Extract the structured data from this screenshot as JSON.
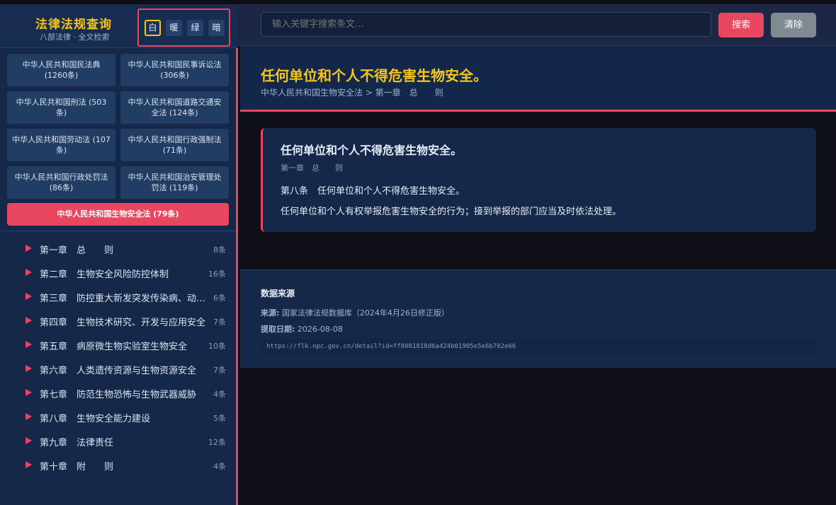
{
  "sidebar": {
    "title": "法律法规查询",
    "subtitle": "八部法律 · 全文检索",
    "themes": [
      {
        "label": "白",
        "active": true
      },
      {
        "label": "暖",
        "active": false
      },
      {
        "label": "绿",
        "active": false
      },
      {
        "label": "暗",
        "active": false
      }
    ],
    "laws": [
      "中华人民共和国民法典 (1260条)",
      "中华人民共和国民事诉讼法 (306条)",
      "中华人民共和国刑法 (503条)",
      "中华人民共和国道路交通安全法 (124条)",
      "中华人民共和国劳动法 (107条)",
      "中华人民共和国行政强制法 (71条)",
      "中华人民共和国行政处罚法 (86条)",
      "中华人民共和国治安管理处罚法 (119条)"
    ],
    "active_law": "中华人民共和国生物安全法 (79条)",
    "chapters": [
      {
        "title": "第一章　总　　则",
        "count": "8条"
      },
      {
        "title": "第二章　生物安全风险防控体制",
        "count": "16条"
      },
      {
        "title": "第三章　防控重大新发突发传染病、动植物疫情",
        "count": "6条"
      },
      {
        "title": "第四章　生物技术研究、开发与应用安全",
        "count": "7条"
      },
      {
        "title": "第五章　病原微生物实验室生物安全",
        "count": "10条"
      },
      {
        "title": "第六章　人类遗传资源与生物资源安全",
        "count": "7条"
      },
      {
        "title": "第七章　防范生物恐怖与生物武器威胁",
        "count": "4条"
      },
      {
        "title": "第八章　生物安全能力建设",
        "count": "5条"
      },
      {
        "title": "第九章　法律责任",
        "count": "12条"
      },
      {
        "title": "第十章　附　　则",
        "count": "4条"
      }
    ]
  },
  "topbar": {
    "search_placeholder": "输入关键字搜索条文...",
    "search_label": "搜索",
    "clear_label": "清除"
  },
  "header": {
    "title": "任何单位和个人不得危害生物安全。",
    "breadcrumb": "中华人民共和国生物安全法 > 第一章　总　　则"
  },
  "card": {
    "title": "任何单位和个人不得危害生物安全。",
    "chapter": "第一章　总　　则",
    "article": "第八条　任何单位和个人不得危害生物安全。",
    "text": "任何单位和个人有权举报危害生物安全的行为；接到举报的部门应当及时依法处理。"
  },
  "source": {
    "heading": "数据来源",
    "source_label": "来源:",
    "source_value": "国家法律法规数据库（2024年4月26日修正版）",
    "date_label": "提取日期:",
    "date_value": "2026-08-08",
    "url": "https://flk.npc.gov.cn/detail?id=ff8081818d6a424b01905e5e6b702e66"
  },
  "colors": {
    "accent": "#e8475f",
    "title_gold": "#f5c518",
    "sidebar_bg": "#15284a",
    "page_bg": "#0f0f17"
  }
}
